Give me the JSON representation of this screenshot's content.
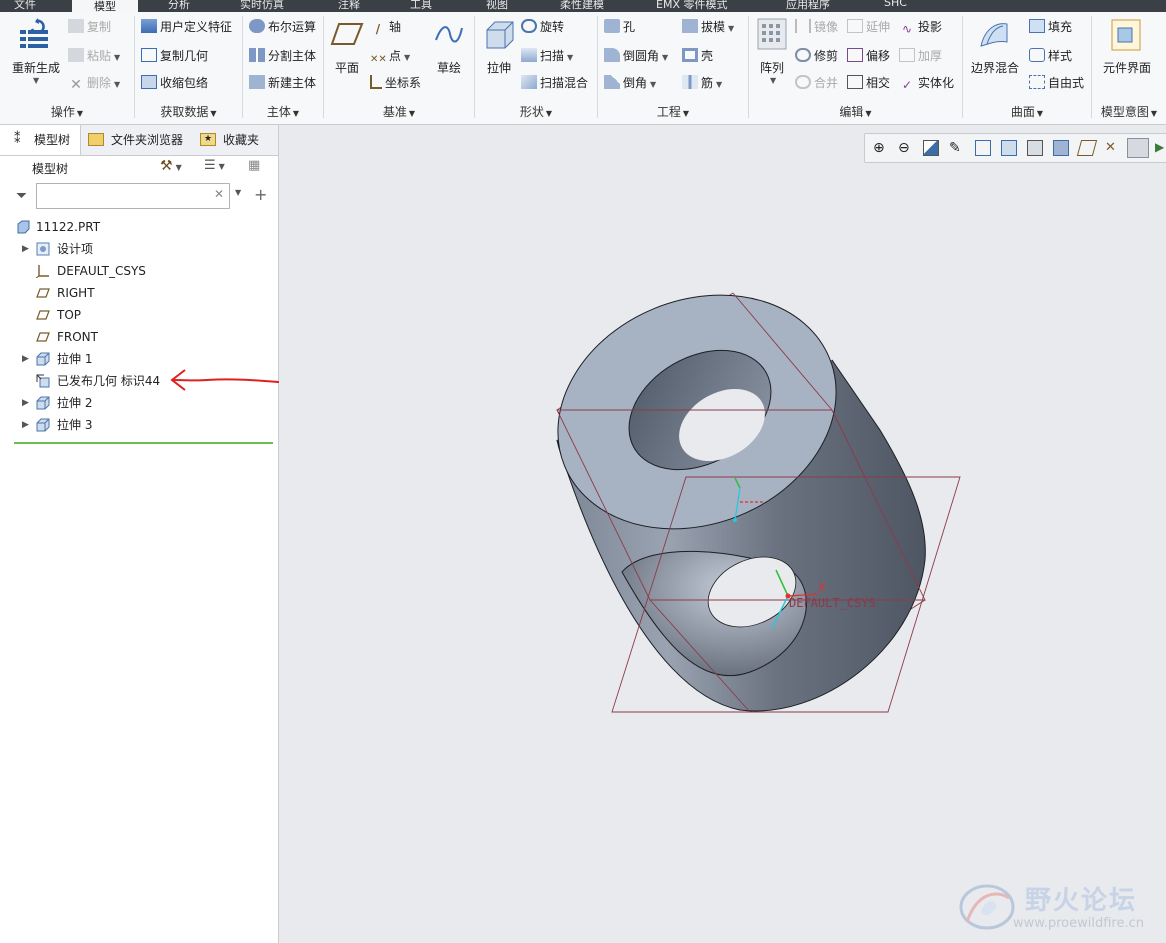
{
  "menu": {
    "tabs": [
      "文件",
      "模型",
      "分析",
      "实时仿真",
      "注释",
      "工具",
      "视图",
      "柔性建模",
      "EMX 零件模式",
      "应用程序",
      "SHC"
    ],
    "active_index": 1
  },
  "ribbon": {
    "operations": {
      "regen": "重新生成",
      "copy": "复制",
      "paste": "粘贴",
      "delete": "删除",
      "label": "操作"
    },
    "get_data": {
      "udf": "用户定义特征",
      "copy_geom": "复制几何",
      "shrinkwrap": "收缩包络",
      "label": "获取数据"
    },
    "body": {
      "boolean": "布尔运算",
      "split": "分割主体",
      "new": "新建主体",
      "label": "主体"
    },
    "datum": {
      "plane": "平面",
      "axis": "轴",
      "point": "点",
      "csys": "坐标系",
      "sketch": "草绘",
      "label": "基准"
    },
    "shapes": {
      "extrude": "拉伸",
      "revolve": "旋转",
      "sweep": "扫描",
      "swept_blend": "扫描混合",
      "label": "形状"
    },
    "engineering": {
      "hole": "孔",
      "round": "倒圆角",
      "chamfer": "倒角",
      "draft": "拔模",
      "shell": "壳",
      "rib": "筋",
      "label": "工程"
    },
    "editing": {
      "pattern": "阵列",
      "mirror": "镜像",
      "trim": "修剪",
      "merge": "合并",
      "extend": "延伸",
      "offset": "偏移",
      "intersect": "相交",
      "project": "投影",
      "thicken": "加厚",
      "solidify": "实体化",
      "label": "编辑"
    },
    "surfaces": {
      "boundary_blend": "边界混合",
      "fill": "填充",
      "style": "样式",
      "freestyle": "自由式",
      "label": "曲面"
    },
    "intent": {
      "component_interface": "元件界面",
      "label": "模型意图"
    }
  },
  "left_panel": {
    "tabs": [
      "模型树",
      "文件夹浏览器",
      "收藏夹"
    ],
    "header_title": "模型树",
    "search_placeholder": "",
    "tree": [
      {
        "label": "11122.PRT",
        "icon": "part-icon",
        "expandable": false
      },
      {
        "label": "设计项",
        "icon": "design-items-icon",
        "expandable": true
      },
      {
        "label": "DEFAULT_CSYS",
        "icon": "csys-icon",
        "expandable": false
      },
      {
        "label": "RIGHT",
        "icon": "datum-plane-icon",
        "expandable": false
      },
      {
        "label": "TOP",
        "icon": "datum-plane-icon",
        "expandable": false
      },
      {
        "label": "FRONT",
        "icon": "datum-plane-icon",
        "expandable": false
      },
      {
        "label": "拉伸 1",
        "icon": "extrude-icon",
        "expandable": true
      },
      {
        "label": "已发布几何 标识44",
        "icon": "published-geometry-icon",
        "expandable": false
      },
      {
        "label": "拉伸 2",
        "icon": "extrude-icon",
        "expandable": true
      },
      {
        "label": "拉伸 3",
        "icon": "extrude-icon",
        "expandable": true
      }
    ]
  },
  "graphics": {
    "csys_label": "DEFAULT_CSYS",
    "axis_x_label": "X",
    "view_toolbar_icons": [
      "zoom-in-icon",
      "zoom-out-icon",
      "refit-icon",
      "repaint-icon",
      "orient-icon",
      "saved-views-icon",
      "display-style-icon",
      "section-icon",
      "datum-display-icon",
      "annotation-display-icon",
      "spin-center-icon",
      "more-icon"
    ]
  },
  "watermark": {
    "title": "野火论坛",
    "url": "www.proewildfire.cn"
  },
  "colors": {
    "annotation_arrow": "#e02020",
    "datum_plane": "#8c3a48",
    "model_face": "#a8b3c4",
    "model_dark": "#5b6270"
  }
}
